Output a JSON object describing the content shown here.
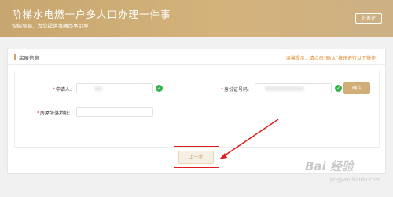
{
  "header": {
    "title": "阶梯水电燃一户多人口办理一件事",
    "subtitle": "智能导服，为您提供准确办事引导",
    "help_button": "好差评"
  },
  "section": {
    "label": "房屋信息",
    "tip": "温馨提示：请点击“确认”按钮进行以下操作"
  },
  "form": {
    "applicant_label": "申请人:",
    "applicant_value": "",
    "id_label": "身份证号码:",
    "id_value": "",
    "confirm_button": "确认",
    "address_label": "房屋坐落地址:",
    "address_value": ""
  },
  "footer": {
    "prev_button": "上一步"
  },
  "watermark": {
    "text": "Bai 经验",
    "sub": "jingyan.baidu.com"
  },
  "colors": {
    "header": "#c8a66f",
    "accent": "#c9a46a",
    "highlight": "#e21c1c",
    "success": "#33b34a"
  }
}
